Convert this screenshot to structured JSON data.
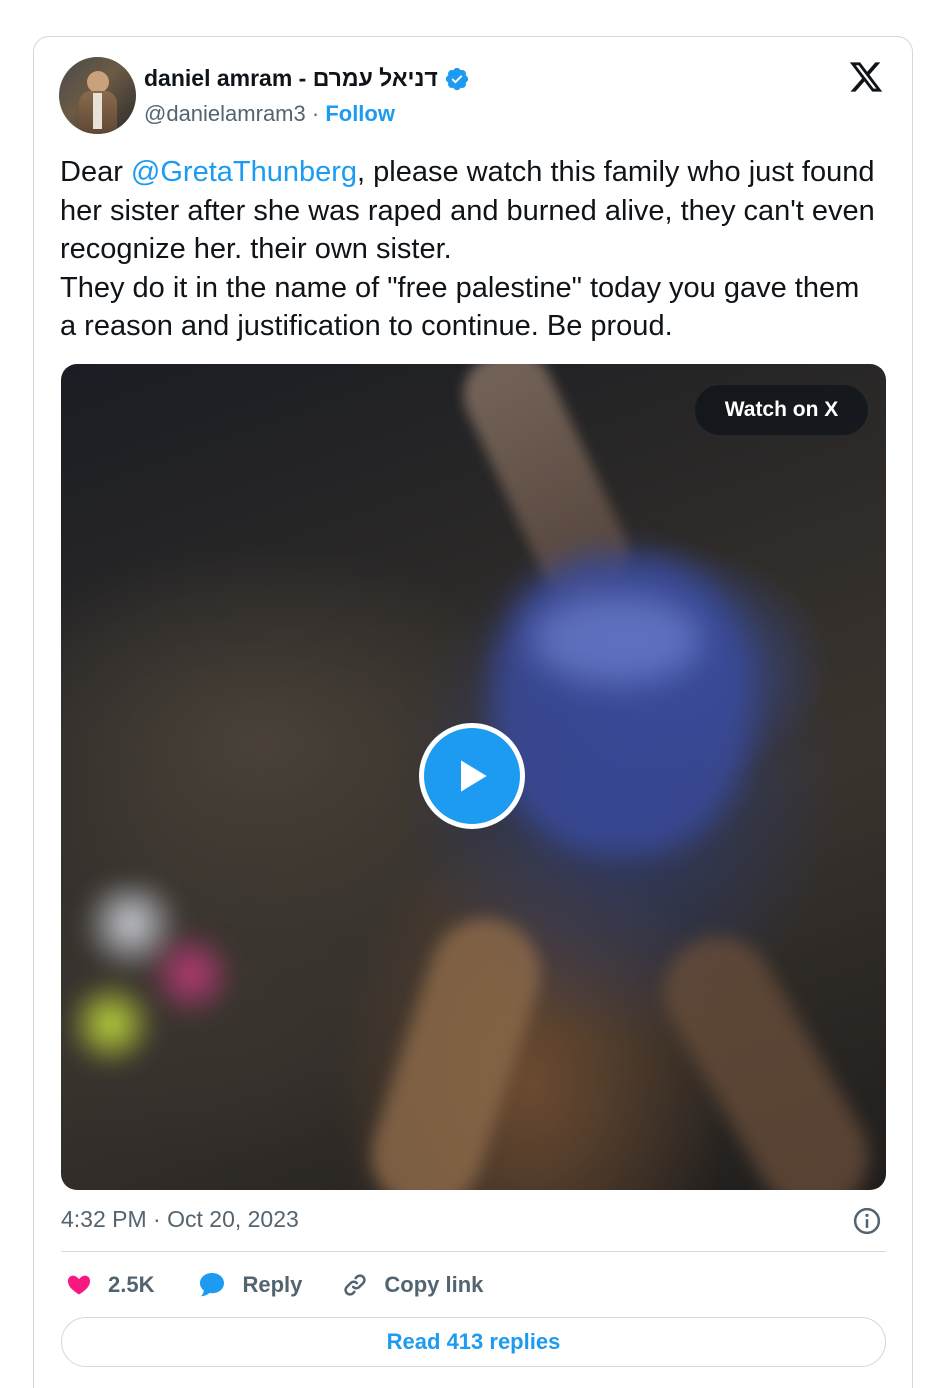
{
  "author": {
    "display_name": "daniel amram - דניאל עמרם",
    "handle": "@danielamram3",
    "separator": "·",
    "follow_label": "Follow",
    "verified_icon": "verified-badge-icon",
    "avatar_icon": "avatar"
  },
  "brand": {
    "logo_icon": "x-logo-icon"
  },
  "tweet": {
    "lead": "Dear ",
    "mention": "@GretaThunberg",
    "line1_rest": ", please watch this family who just found her sister after she was raped and burned alive, they can't even recognize her. their own sister.",
    "line2": "They do it in the name of \"free palestine\" today you gave them a reason and justification to continue. Be proud."
  },
  "media": {
    "watch_label": "Watch on X",
    "play_icon": "play-icon"
  },
  "meta": {
    "time": "4:32 PM",
    "dot": " · ",
    "date": "Oct 20, 2023",
    "info_icon": "info-icon"
  },
  "actions": {
    "likes_count": "2.5K",
    "reply_label": "Reply",
    "copy_label": "Copy link"
  },
  "footer": {
    "read_replies_label": "Read 413 replies"
  },
  "colors": {
    "accent": "#1d9bf0",
    "heart": "#f91880",
    "text": "#0f1419",
    "muted": "#536471",
    "border": "#cfd9de"
  }
}
